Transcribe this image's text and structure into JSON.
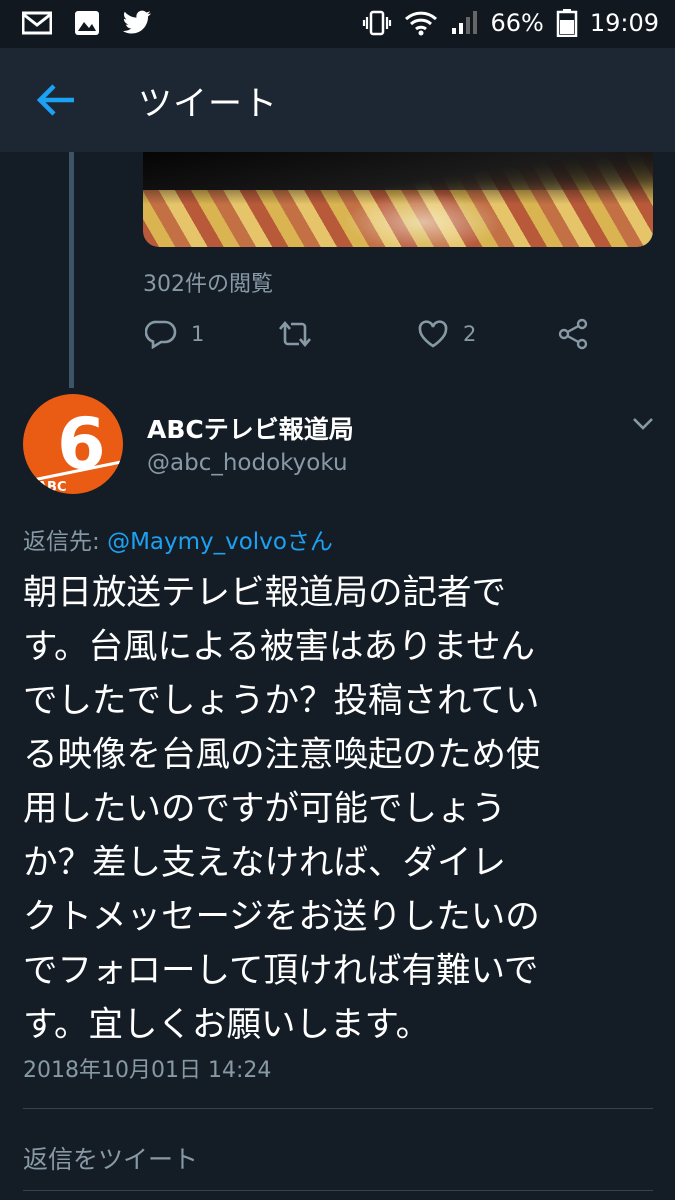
{
  "status_bar": {
    "battery": "66%",
    "time": "19:09",
    "left_icons": [
      "gmail-icon",
      "gallery-icon",
      "twitter-icon"
    ],
    "right_icons": [
      "vibrate-icon",
      "wifi-icon",
      "signal-icon",
      "battery-icon"
    ]
  },
  "header": {
    "title": "ツイート",
    "back_icon": "back-arrow-icon"
  },
  "previous_tweet": {
    "views": "302件の閲覧",
    "actions": {
      "reply_count": "1",
      "retweet_count": "",
      "like_count": "2"
    }
  },
  "tweet": {
    "author_name": "ABCテレビ報道局",
    "author_handle": "@abc_hodokyoku",
    "avatar_text": "6",
    "avatar_sub": "ABC",
    "reply_prefix": "返信先: ",
    "reply_mention": "@Maymy_volvoさん",
    "body_lines": [
      "朝日放送テレビ報道局の記者で",
      "す。台風による被害はありません",
      "でしたでしょうか？投稿されてい",
      "る映像を台風の注意喚起のため使",
      "用したいのですが可能でしょう",
      "か？差し支えなければ、ダイレ",
      "クトメッセージをお送りしたいの",
      "でフォローして頂ければ有難いで",
      "す。宜しくお願いします。"
    ],
    "timestamp": "2018年10月01日 14:24"
  },
  "reply_input": {
    "placeholder": "返信をツイート"
  },
  "colors": {
    "background": "#141d26",
    "header": "#1c2733",
    "secondary_text": "#8899a6",
    "link": "#1da1f2",
    "avatar": "#ea5b13"
  }
}
